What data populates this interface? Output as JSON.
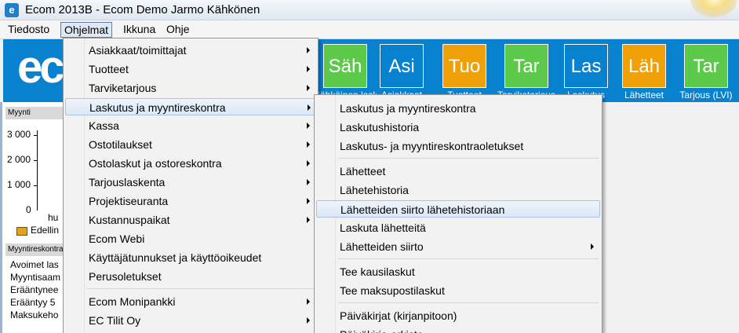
{
  "window": {
    "title": "Ecom 2013B - Ecom Demo Jarmo Kähkönen",
    "app_icon": "e"
  },
  "menubar": [
    "Tiedosto",
    "Ohjelmat",
    "Ikkuna",
    "Ohje"
  ],
  "toolbar": {
    "logo": "ec",
    "tiles": [
      {
        "abbr": "Säh",
        "label": "Sähköinen lasku",
        "color": "#5cc94a"
      },
      {
        "abbr": "Asi",
        "label": "Asiakkaat",
        "color": "#0882cf"
      },
      {
        "abbr": "Tuo",
        "label": "Tuotteet",
        "color": "#f0a10a"
      },
      {
        "abbr": "Tar",
        "label": "Tarviketarjous",
        "color": "#5cc94a"
      },
      {
        "abbr": "Las",
        "label": "Laskutus",
        "color": "#0882cf"
      },
      {
        "abbr": "Läh",
        "label": "Lähetteet",
        "color": "#f0a10a"
      },
      {
        "abbr": "Tar",
        "label": "Tarjous (LVI)",
        "color": "#5cc94a"
      }
    ]
  },
  "left_panel": {
    "myynti_header": "Myynti",
    "ticks": [
      "3 000",
      "2 000",
      "1 000",
      "0"
    ],
    "x_label": "hu",
    "legend": "Edellin",
    "myyntireskontra_header": "Myyntireskontra",
    "rows": [
      "Avoimet las",
      "Myyntisaam",
      "Erääntynee",
      "Erääntyy 5",
      "Maksukeho"
    ]
  },
  "ohjelmat_menu": [
    {
      "label": "Asiakkaat/toimittajat",
      "sub": true
    },
    {
      "label": "Tuotteet",
      "sub": true
    },
    {
      "label": "Tarviketarjous",
      "sub": true
    },
    {
      "label": "Laskutus ja myyntireskontra",
      "sub": true
    },
    {
      "label": "Kassa",
      "sub": true
    },
    {
      "label": "Ostotilaukset",
      "sub": true
    },
    {
      "label": "Ostolaskut ja ostoreskontra",
      "sub": true
    },
    {
      "label": "Tarjouslaskenta",
      "sub": true
    },
    {
      "label": "Projektiseuranta",
      "sub": true
    },
    {
      "label": "Kustannuspaikat",
      "sub": true
    },
    {
      "label": "Ecom Webi",
      "sub": false
    },
    {
      "label": "Käyttäjätunnukset ja käyttöoikeudet",
      "sub": false
    },
    {
      "label": "Perusoletukset",
      "sub": false
    },
    {
      "label": "Ecom Monipankki",
      "sub": true
    },
    {
      "label": "EC Tilit Oy",
      "sub": true
    }
  ],
  "laskutus_submenu": [
    {
      "label": "Laskutus ja myyntireskontra",
      "sub": false
    },
    {
      "label": "Laskutushistoria",
      "sub": false
    },
    {
      "label": "Laskutus- ja myyntireskontraoletukset",
      "sub": false
    },
    {
      "label": "Lähetteet",
      "sub": false
    },
    {
      "label": "Lähetehistoria",
      "sub": false
    },
    {
      "label": "Lähetteiden siirto lähetehistoriaan",
      "sub": false
    },
    {
      "label": "Laskuta lähetteitä",
      "sub": false
    },
    {
      "label": "Lähetteiden siirto",
      "sub": true
    },
    {
      "label": "Tee kausilaskut",
      "sub": false
    },
    {
      "label": "Tee maksupostilaskut",
      "sub": false
    },
    {
      "label": "Päiväkirjat (kirjanpitoon)",
      "sub": false
    },
    {
      "label": "Päiväkirja-arkisto",
      "sub": false
    }
  ]
}
